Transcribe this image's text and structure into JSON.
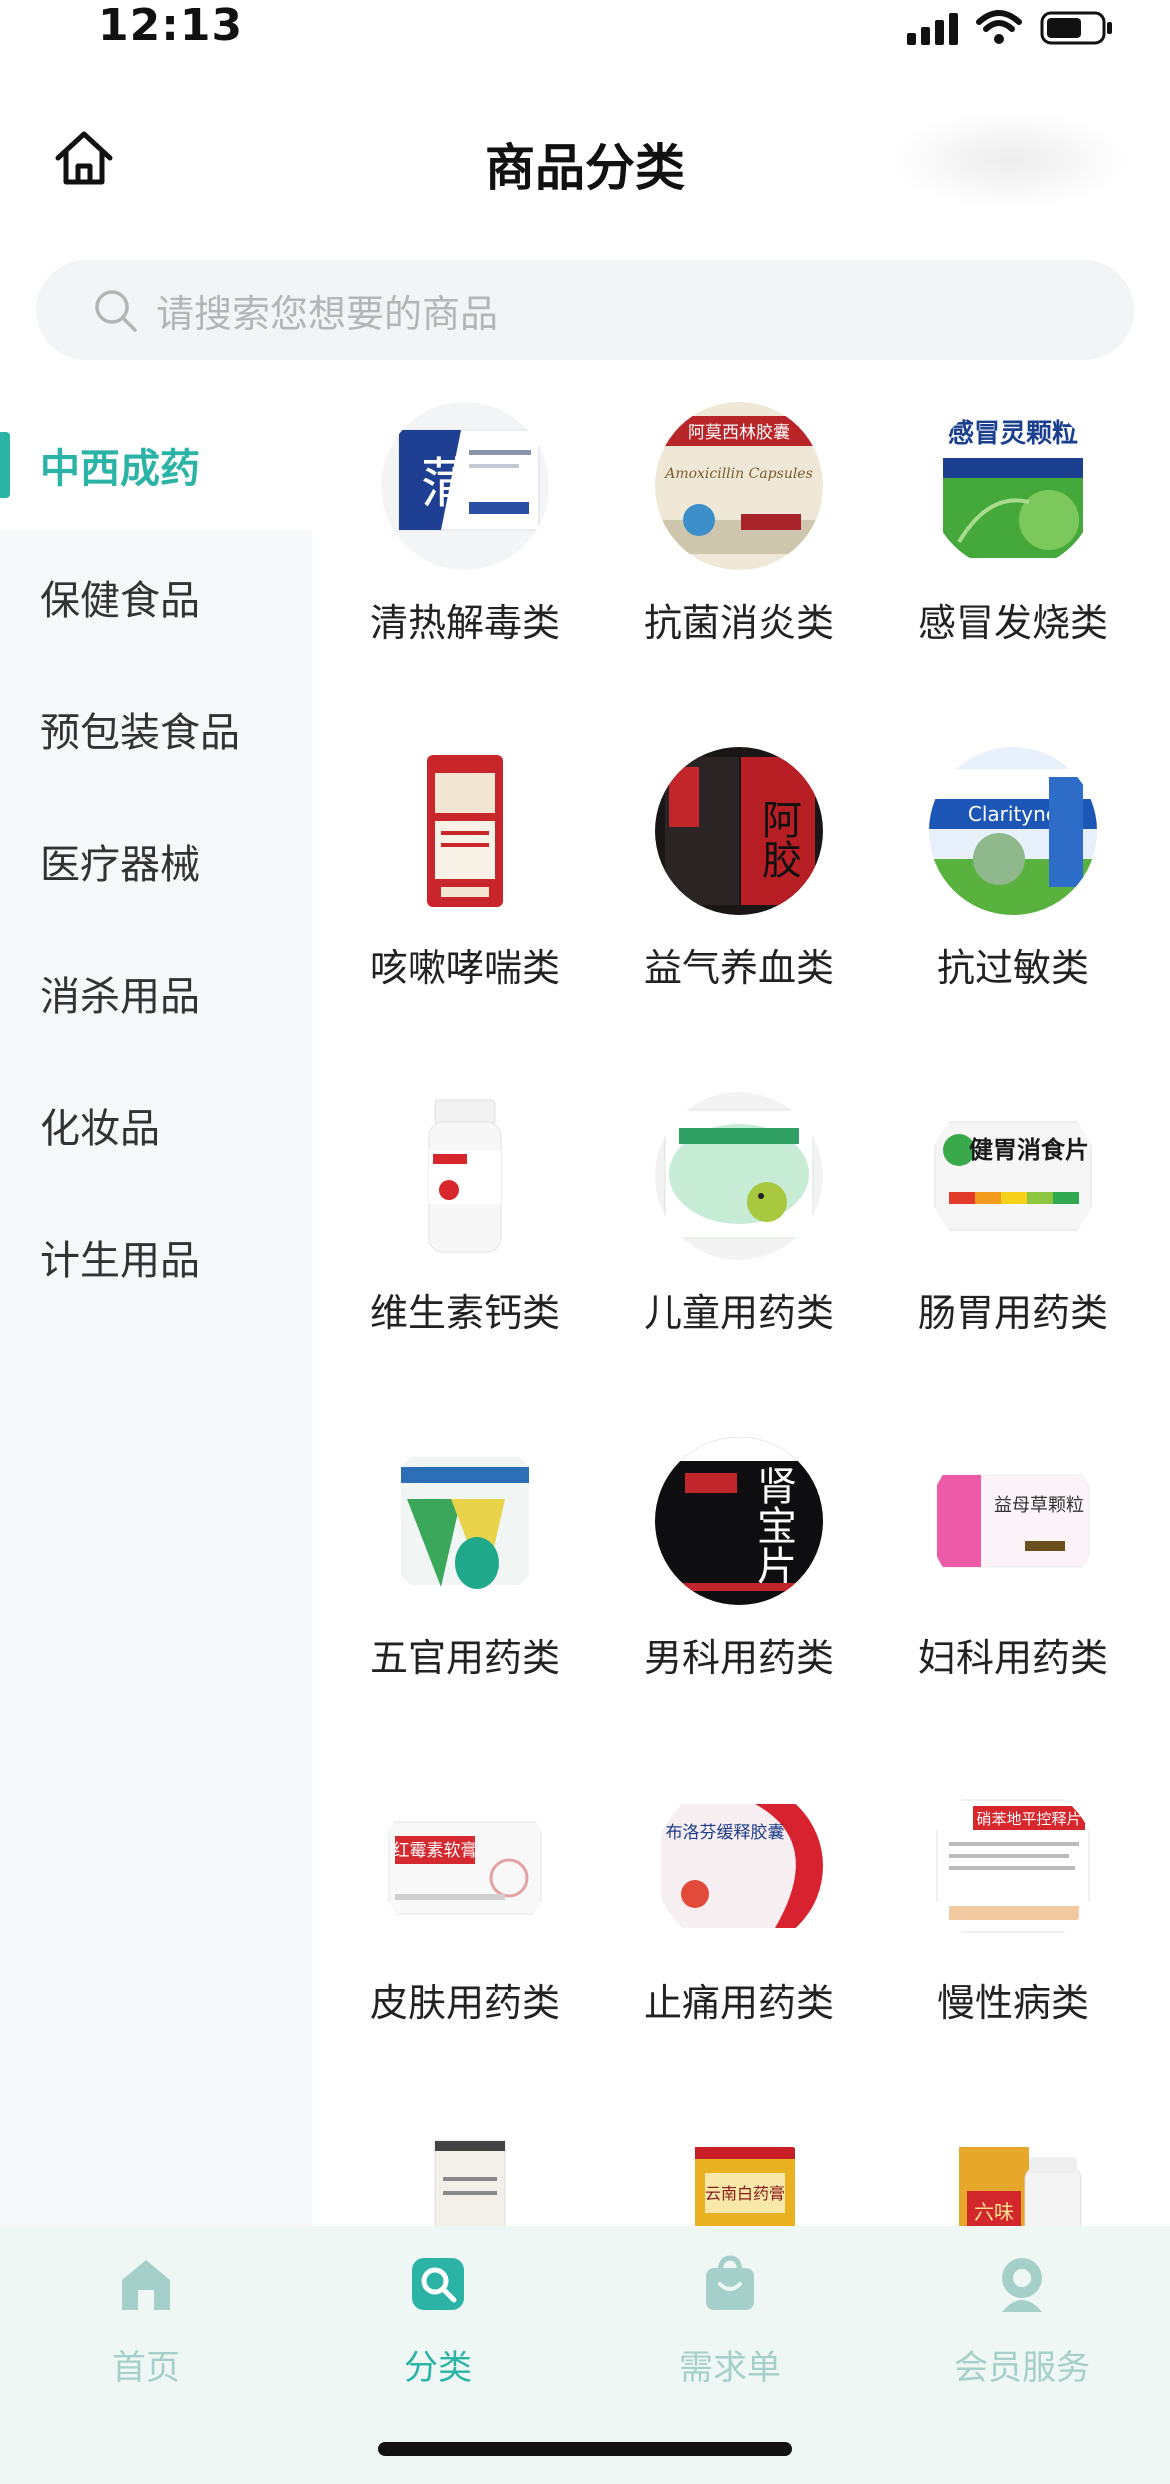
{
  "status_bar": {
    "time": "12:13"
  },
  "header": {
    "title": "商品分类"
  },
  "search": {
    "placeholder": "请搜索您想要的商品"
  },
  "sidebar": {
    "items": [
      {
        "label": "中西成药",
        "active": true
      },
      {
        "label": "保健食品",
        "active": false
      },
      {
        "label": "预包装食品",
        "active": false
      },
      {
        "label": "医疗器械",
        "active": false
      },
      {
        "label": "消杀用品",
        "active": false
      },
      {
        "label": "化妆品",
        "active": false
      },
      {
        "label": "计生用品",
        "active": false
      }
    ]
  },
  "categories": [
    {
      "label": "清热解毒类",
      "image_text": "蒲"
    },
    {
      "label": "抗菌消炎类",
      "image_text": "阿莫西林胶囊"
    },
    {
      "label": "感冒发烧类",
      "image_text": "感冒灵颗粒"
    },
    {
      "label": "咳嗽哮喘类",
      "image_text": ""
    },
    {
      "label": "益气养血类",
      "image_text": "阿胶"
    },
    {
      "label": "抗过敏类",
      "image_text": "Clarityne"
    },
    {
      "label": "维生素钙类",
      "image_text": ""
    },
    {
      "label": "儿童用药类",
      "image_text": ""
    },
    {
      "label": "肠胃用药类",
      "image_text": "健胃消食片"
    },
    {
      "label": "五官用药类",
      "image_text": ""
    },
    {
      "label": "男科用药类",
      "image_text": "肾宝片"
    },
    {
      "label": "妇科用药类",
      "image_text": "益母草颗粒"
    },
    {
      "label": "皮肤用药类",
      "image_text": "红霉素软膏"
    },
    {
      "label": "止痛用药类",
      "image_text": "布洛芬缓释胶囊"
    },
    {
      "label": "慢性病类",
      "image_text": "硝苯地平控释片"
    },
    {
      "label": "",
      "image_text": ""
    },
    {
      "label": "",
      "image_text": "云南白药膏"
    },
    {
      "label": "",
      "image_text": "六味"
    }
  ],
  "bottom_nav": {
    "items": [
      {
        "label": "首页",
        "active": false
      },
      {
        "label": "分类",
        "active": true
      },
      {
        "label": "需求单",
        "active": false
      },
      {
        "label": "会员服务",
        "active": false
      }
    ]
  },
  "colors": {
    "accent": "#2bb3a6",
    "nav_inactive": "#a5cfc9",
    "sidebar_bg": "#f7f8fa",
    "nav_bg": "#eef7f4"
  }
}
